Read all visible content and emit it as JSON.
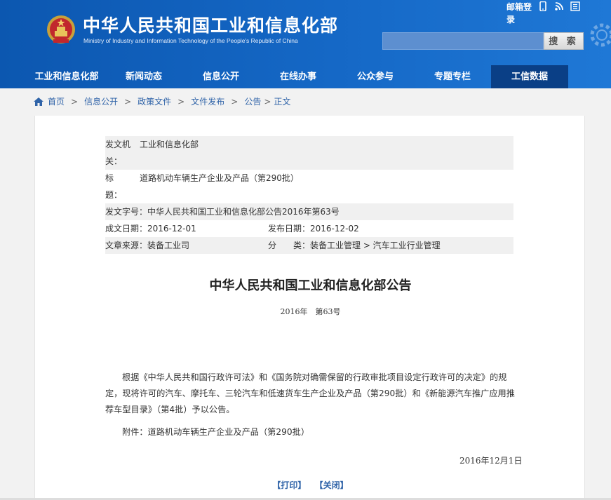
{
  "header": {
    "title": "中华人民共和国工业和信息化部",
    "subtitle": "Ministry of Industry and Information Technology of the People's Republic of China",
    "mail_link": "邮箱登录",
    "search_button": "搜 索",
    "search_placeholder": "",
    "icons": [
      "mobile-icon",
      "rss-icon",
      "list-icon"
    ]
  },
  "nav": {
    "items": [
      "工业和信息化部",
      "新闻动态",
      "信息公开",
      "在线办事",
      "公众参与",
      "专题专栏",
      "工信数据"
    ],
    "active_index": 6
  },
  "breadcrumb": {
    "items": [
      "首页",
      "信息公开",
      "政策文件",
      "文件发布",
      "公告",
      "正文"
    ],
    "separator": ">"
  },
  "meta": {
    "issuer_label_1": "发文机",
    "issuer_label_2": "关：",
    "issuer_value": "工业和信息化部",
    "title_label_1": "标",
    "title_label_2": "题：",
    "title_value": "道路机动车辆生产企业及产品（第290批）",
    "doc_number": "发文字号：中华人民共和国工业和信息化部公告2016年第63号",
    "written_date": "成文日期：2016-12-01",
    "publish_date": "发布日期：2016-12-02",
    "source": "文章来源：装备工业司",
    "category": "分　　类：装备工业管理 > 汽车工业行业管理"
  },
  "document": {
    "title": "中华人民共和国工业和信息化部公告",
    "number": "2016年　第63号",
    "body": "根据《中华人民共和国行政许可法》和《国务院对确需保留的行政审批项目设定行政许可的决定》的规定，现将许可的汽车、摩托车、三轮汽车和低速货车生产企业及产品（第290批）和《新能源汽车推广应用推荐车型目录》（第4批）予以公告。",
    "attachment": "附件：道路机动车辆生产企业及产品（第290批）",
    "sign_date": "2016年12月1日",
    "print_label": "【打印】",
    "close_label": "【关闭】"
  },
  "colors": {
    "header_blue": "#1568c6",
    "nav_active": "#0a3f86",
    "link_blue": "#2f63a8",
    "meta_shade": "#f0f0f0"
  }
}
